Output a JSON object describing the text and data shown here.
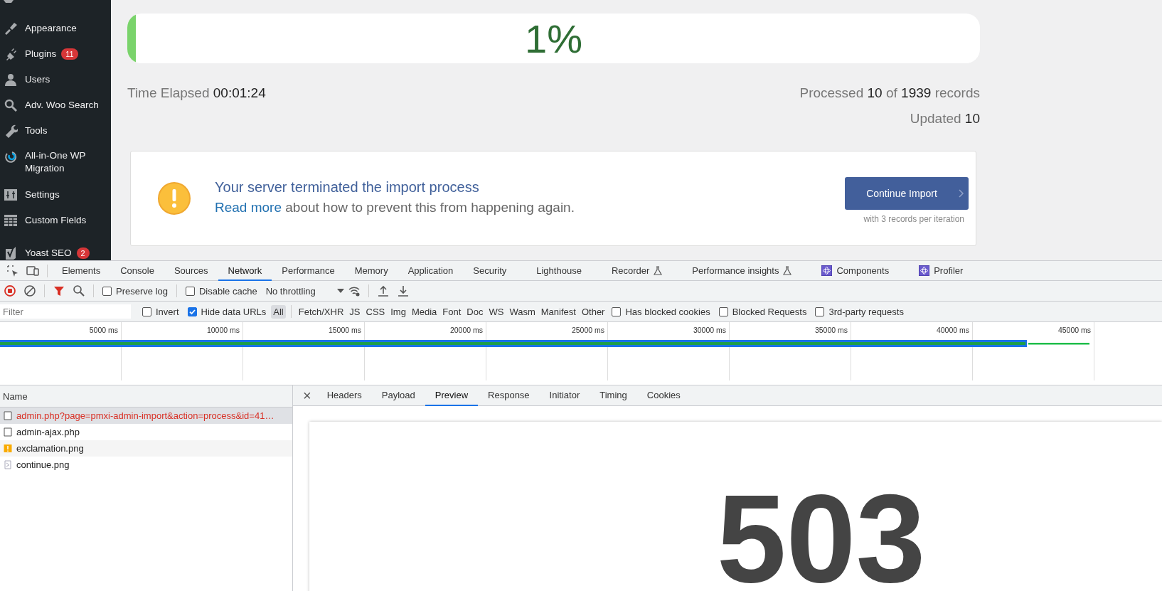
{
  "sidebar": {
    "items": [
      {
        "label": "Appearance"
      },
      {
        "label": "Plugins",
        "badge": "11"
      },
      {
        "label": "Users"
      },
      {
        "label": "Adv. Woo Search"
      },
      {
        "label": "Tools"
      },
      {
        "label": "All-in-One WP Migration"
      },
      {
        "label": "Settings"
      },
      {
        "label": "Custom Fields"
      },
      {
        "label": "Yoast SEO",
        "badge": "2"
      }
    ]
  },
  "import": {
    "progress": {
      "level": 0.01,
      "label": "1%"
    },
    "time_elapsed": {
      "label": "Time Elapsed",
      "value": "00:01:24"
    },
    "processed": {
      "label": "Processed",
      "count": "10",
      "of": "of",
      "total": "1939",
      "unit": "records"
    },
    "updated": {
      "label": "Updated",
      "value": "10"
    },
    "notice": {
      "title": "Your server terminated the import process",
      "link": "Read more",
      "message": "about how to prevent this from happening again.",
      "button": "Continue Import",
      "hint": "with 3 records per iteration"
    }
  },
  "devtools": {
    "tabs": [
      {
        "label": "Elements",
        "selected": false,
        "kind": "plain"
      },
      {
        "label": "Console",
        "selected": false,
        "kind": "plain"
      },
      {
        "label": "Sources",
        "selected": false,
        "kind": "plain"
      },
      {
        "label": "Network",
        "selected": true,
        "kind": "plain"
      },
      {
        "label": "Performance",
        "selected": false,
        "kind": "plain"
      },
      {
        "label": "Memory",
        "selected": false,
        "kind": "plain"
      },
      {
        "label": "Application",
        "selected": false,
        "kind": "plain"
      },
      {
        "label": "Security",
        "selected": false,
        "kind": "plain"
      },
      {
        "label": "Lighthouse",
        "selected": false,
        "kind": "plain"
      },
      {
        "label": "Recorder",
        "selected": false,
        "kind": "experiment"
      },
      {
        "label": "Performance insights",
        "selected": false,
        "kind": "experiment"
      },
      {
        "label": "Components",
        "selected": false,
        "kind": "react"
      },
      {
        "label": "Profiler",
        "selected": false,
        "kind": "react"
      }
    ],
    "toolbar": {
      "preserve_log": {
        "label": "Preserve log",
        "checked": false
      },
      "disable_cache": {
        "label": "Disable cache",
        "checked": false
      },
      "throttling": "No throttling"
    },
    "filter": {
      "placeholder": "Filter",
      "invert": {
        "label": "Invert",
        "checked": false
      },
      "hide_data_urls": {
        "label": "Hide data URLs",
        "checked": true
      },
      "types": [
        {
          "label": "All",
          "selected": true
        },
        {
          "label": "Fetch/XHR",
          "selected": false
        },
        {
          "label": "JS",
          "selected": false
        },
        {
          "label": "CSS",
          "selected": false
        },
        {
          "label": "Img",
          "selected": false
        },
        {
          "label": "Media",
          "selected": false
        },
        {
          "label": "Font",
          "selected": false
        },
        {
          "label": "Doc",
          "selected": false
        },
        {
          "label": "WS",
          "selected": false
        },
        {
          "label": "Wasm",
          "selected": false
        },
        {
          "label": "Manifest",
          "selected": false
        },
        {
          "label": "Other",
          "selected": false
        }
      ],
      "options": [
        {
          "label": "Has blocked cookies",
          "checked": false
        },
        {
          "label": "Blocked Requests",
          "checked": false
        },
        {
          "label": "3rd-party requests",
          "checked": false
        }
      ]
    },
    "timeline": {
      "ticks": [
        "5000 ms",
        "10000 ms",
        "15000 ms",
        "20000 ms",
        "25000 ms",
        "30000 ms",
        "35000 ms",
        "40000 ms",
        "45000 ms"
      ]
    },
    "requests": {
      "column": "Name",
      "rows": [
        {
          "name": "admin.php?page=pmxi-admin-import&action=process&id=41…",
          "selected": true,
          "failed": true,
          "kind": "document"
        },
        {
          "name": "admin-ajax.php",
          "selected": false,
          "failed": false,
          "kind": "document"
        },
        {
          "name": "exclamation.png",
          "selected": false,
          "failed": false,
          "kind": "image-warning"
        },
        {
          "name": "continue.png",
          "selected": false,
          "failed": false,
          "kind": "image"
        }
      ]
    },
    "detail": {
      "close": "×",
      "tabs": [
        {
          "label": "Headers",
          "selected": false
        },
        {
          "label": "Payload",
          "selected": false
        },
        {
          "label": "Preview",
          "selected": true
        },
        {
          "label": "Response",
          "selected": false
        },
        {
          "label": "Initiator",
          "selected": false
        },
        {
          "label": "Timing",
          "selected": false
        },
        {
          "label": "Cookies",
          "selected": false
        }
      ],
      "preview": "503"
    }
  }
}
